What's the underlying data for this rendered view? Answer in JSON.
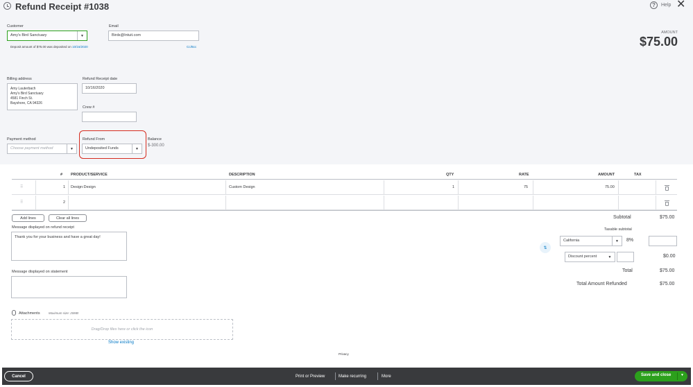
{
  "header": {
    "title": "Refund Receipt #1038",
    "help_label": "Help",
    "close_glyph": "✕",
    "icons": [
      "history-icon",
      "help-icon",
      "close-icon"
    ]
  },
  "customer": {
    "label": "Customer",
    "value": "Amy's Bird Sanctuary",
    "deposit_note_prefix": "Deposit amount of $75.00 was deposited on",
    "deposit_date_link": "10/16/2020"
  },
  "email": {
    "label": "Email",
    "value": "Birds@Intuit.com",
    "cc_bcc": "Cc/Bcc"
  },
  "amount": {
    "label": "AMOUNT",
    "value": "$75.00"
  },
  "billing": {
    "label": "Billing address",
    "lines": [
      "Amy Lauterbach",
      "Amy's Bird Sanctuary",
      "4581 Finch St.",
      "Bayshore, CA  94326"
    ]
  },
  "receipt_date": {
    "label": "Refund Receipt date",
    "value": "10/16/2020"
  },
  "crew": {
    "label": "Crew #",
    "value": ""
  },
  "payment_method": {
    "label": "Payment method",
    "placeholder": "Choose payment method"
  },
  "refund_from": {
    "label": "Refund From",
    "value": "Undeposited Funds"
  },
  "balance": {
    "label": "Balance",
    "value": "$-300.00"
  },
  "table": {
    "columns": {
      "num": "#",
      "product": "PRODUCT/SERVICE",
      "description": "DESCRIPTION",
      "qty": "QTY",
      "rate": "RATE",
      "amount": "AMOUNT",
      "tax": "TAX"
    },
    "rows": [
      {
        "num": "1",
        "product": "Design:Design",
        "description": "Custom Design",
        "qty": "1",
        "rate": "75",
        "amount": "75.00",
        "tax": ""
      },
      {
        "num": "2",
        "product": "",
        "description": "",
        "qty": "",
        "rate": "",
        "amount": "",
        "tax": ""
      }
    ]
  },
  "buttons": {
    "add_lines": "Add lines",
    "clear_all_lines": "Clear all lines"
  },
  "messages": {
    "receipt_label": "Message displayed on refund receipt",
    "receipt_value": "Thank you for your business and have a great day!",
    "statement_label": "Message displayed on statement",
    "statement_value": ""
  },
  "attachments": {
    "label": "Attachments",
    "max_size": "Maximum size: 20MB",
    "drop_hint": "Drag/Drop files here or click the icon",
    "show_existing": "Show existing"
  },
  "totals": {
    "subtotal_label": "Subtotal",
    "subtotal_value": "$75.00",
    "taxable_subtotal_label": "Taxable subtotal",
    "tax_region": "California",
    "tax_rate": "8%",
    "tax_amount_input": "",
    "discount_type": "Discount percent",
    "discount_input": "",
    "discount_value": "$0.00",
    "total_label": "Total",
    "total_value": "$75.00",
    "refunded_label": "Total Amount Refunded",
    "refunded_value": "$75.00"
  },
  "privacy": "Privacy",
  "footer": {
    "cancel": "Cancel",
    "print_preview": "Print or Preview",
    "make_recurring": "Make recurring",
    "more": "More",
    "save_close": "Save and close"
  },
  "colors": {
    "top_bg": "#f4f5f8",
    "footer_bg": "#393a3d",
    "save_green": "#2ca01c",
    "highlight_red": "#d52b1e",
    "link_blue": "#0077c5"
  }
}
